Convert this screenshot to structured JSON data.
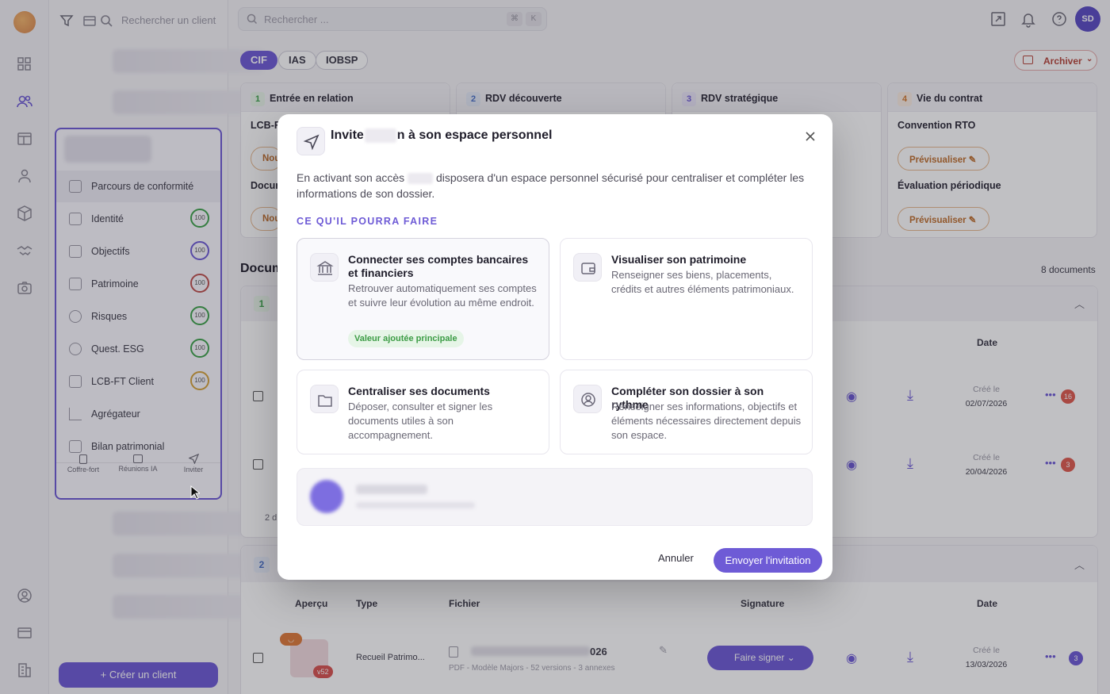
{
  "topbar": {
    "search_placeholder": "Rechercher ...",
    "kbd_cmd": "⌘",
    "kbd_k": "K",
    "avatar_initials": "SD"
  },
  "clients": {
    "search_placeholder": "Rechercher un client",
    "create_label": "Créer un client"
  },
  "regulations": {
    "tabs": [
      "CIF",
      "IAS",
      "IOBSP"
    ],
    "active": "CIF",
    "archive_label": "Archiver"
  },
  "stages": [
    {
      "num": "1",
      "title": "Entrée en relation",
      "lines": [
        "LCB-F",
        "Docur"
      ],
      "btn": "Nou"
    },
    {
      "num": "2",
      "title": "RDV découverte"
    },
    {
      "num": "3",
      "title": "RDV stratégique"
    },
    {
      "num": "4",
      "title": "Vie du contrat",
      "doc1": "Convention RTO",
      "doc2": "Évaluation périodique",
      "preview_label": "Prévisualiser"
    }
  ],
  "documents": {
    "heading": "Docum",
    "count_label": "8 documents",
    "group1_num": "1",
    "group2_num": "2",
    "date_header": "Date",
    "rows_group1": [
      {
        "created_label": "Créé le",
        "date": "02/07/2026",
        "comments": "16"
      },
      {
        "created_label": "Créé le",
        "date": "20/04/2026",
        "comments": "3"
      }
    ],
    "footer_left": "2 d",
    "table2_headers": {
      "apercu": "Aperçu",
      "type": "Type",
      "fichier": "Fichier",
      "signature": "Signature",
      "date": "Date"
    },
    "row2": {
      "type": "Recueil Patrimo...",
      "file_suffix": "026",
      "meta": "PDF - Modèle Majors - 52 versions - 3 annexes",
      "version": "v52",
      "sign_label": "Faire signer",
      "created_label": "Créé le",
      "date": "13/03/2026",
      "comments": "3"
    }
  },
  "client_menu": {
    "header": "Parcours de conformité",
    "items": [
      {
        "label": "Identité",
        "score": "100",
        "color": "#3ea24a"
      },
      {
        "label": "Objectifs",
        "score": "100",
        "color": "#6e5bd6"
      },
      {
        "label": "Patrimoine",
        "score": "100",
        "color": "#c0504d"
      },
      {
        "label": "Risques",
        "score": "100",
        "color": "#3ea24a"
      },
      {
        "label": "Quest. ESG",
        "score": "100",
        "color": "#3ea24a"
      },
      {
        "label": "LCB-FT Client",
        "score": "100",
        "color": "#d6a33a"
      },
      {
        "label": "Agrégateur",
        "score": "",
        "color": ""
      },
      {
        "label": "Bilan patrimonial",
        "score": "",
        "color": ""
      }
    ],
    "footer": [
      "Coffre-fort",
      "Réunions IA",
      "Inviter"
    ]
  },
  "modal": {
    "title_prefix": "Invite",
    "title_suffix": "n à son espace personnel",
    "desc_prefix": "En activant son accès",
    "desc_suffix": "disposera d'un espace personnel sécurisé pour centraliser et compléter les informations de son dossier.",
    "section_title": "CE QU'IL POURRA FAIRE",
    "features": [
      {
        "icon": "bank-icon",
        "title": "Connecter ses comptes bancaires et financiers",
        "desc": "Retrouver automatiquement ses comptes et suivre leur évolution au même endroit.",
        "badge": "Valeur ajoutée principale"
      },
      {
        "icon": "wallet-icon",
        "title": "Visualiser son patrimoine",
        "desc": "Renseigner ses biens, placements, crédits et autres éléments patrimoniaux."
      },
      {
        "icon": "folder-icon",
        "title": "Centraliser ses documents",
        "desc": "Déposer, consulter et signer les documents utiles à son accompagnement."
      },
      {
        "icon": "user-circle-icon",
        "title": "Compléter son dossier à son rythme",
        "desc": "Renseigner ses informations, objectifs et éléments nécessaires directement depuis son espace."
      }
    ],
    "cancel_label": "Annuler",
    "send_label": "Envoyer l'invitation"
  }
}
